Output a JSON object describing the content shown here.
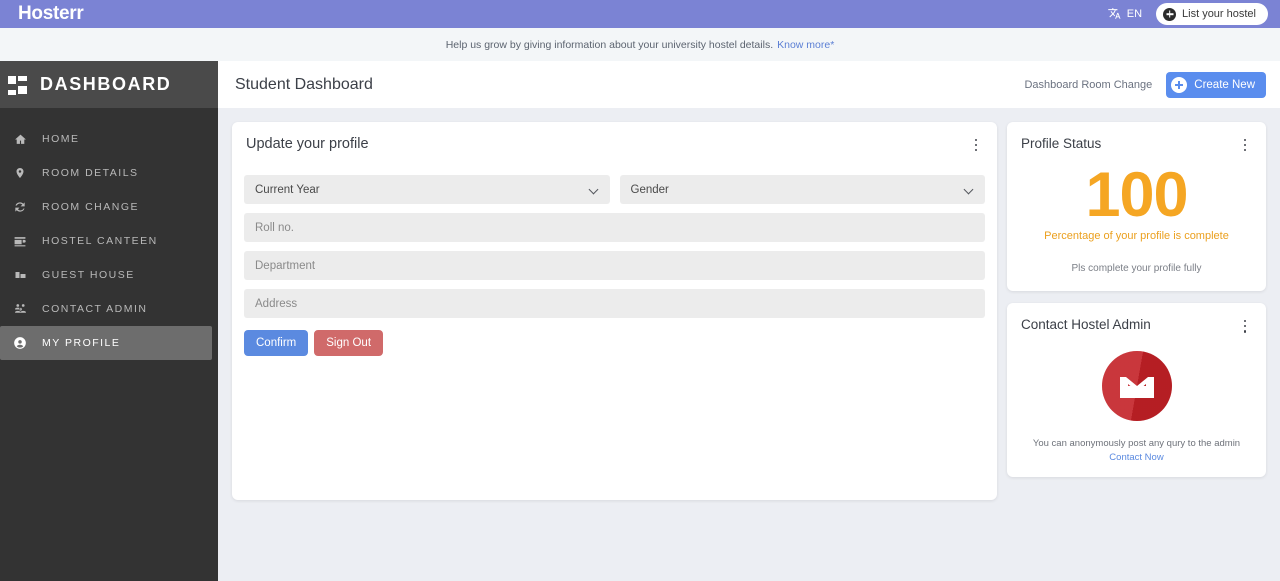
{
  "topbar": {
    "brand": "Hosterr",
    "language": "EN",
    "language_icon": "translate-icon",
    "list_hostel_label": "List your hostel",
    "list_hostel_icon": "plus-circle-icon",
    "background": "#7b83d4"
  },
  "notice": {
    "text": "Help us grow by giving information about your university hostel details.",
    "link_label": "Know more*"
  },
  "sidebar": {
    "title": "DASHBOARD",
    "logo_icon": "dashboard-grid-icon",
    "background": "#333333",
    "active_background": "#6d6d6d",
    "items": [
      {
        "label": "HOME",
        "icon": "home-icon",
        "active": false
      },
      {
        "label": "ROOM DETAILS",
        "icon": "map-pin-icon",
        "active": false
      },
      {
        "label": "ROOM CHANGE",
        "icon": "refresh-icon",
        "active": false
      },
      {
        "label": "HOSTEL CANTEEN",
        "icon": "canteen-icon",
        "active": false
      },
      {
        "label": "GUEST HOUSE",
        "icon": "building-icon",
        "active": false
      },
      {
        "label": "CONTACT ADMIN",
        "icon": "people-group-icon",
        "active": false
      },
      {
        "label": "MY PROFILE",
        "icon": "user-circle-icon",
        "active": true
      }
    ]
  },
  "page_header": {
    "title": "Student Dashboard",
    "breadcrumb": "Dashboard Room Change",
    "create_button_label": "Create New",
    "create_button_icon": "plus-circle-icon",
    "create_button_color": "#5a8dee"
  },
  "profile_form": {
    "title": "Update your profile",
    "menu_icon": "kebab-menu-icon",
    "year_select": {
      "value": "Current Year",
      "icon": "chevron-down-icon"
    },
    "gender_select": {
      "value": "Gender",
      "icon": "chevron-down-icon"
    },
    "roll_no": {
      "value": "",
      "placeholder": "Roll no."
    },
    "department": {
      "value": "",
      "placeholder": "Department"
    },
    "address": {
      "value": "",
      "placeholder": "Address"
    },
    "confirm_label": "Confirm",
    "signout_label": "Sign Out",
    "confirm_color": "#5b8ae0",
    "signout_color": "#d06a6a"
  },
  "profile_status": {
    "title": "Profile Status",
    "menu_icon": "kebab-menu-icon",
    "percentage": "100",
    "percentage_caption": "Percentage of your profile is complete",
    "note": "Pls complete your profile fully",
    "accent_color": "#f5a623"
  },
  "contact_admin": {
    "title": "Contact Hostel Admin",
    "menu_icon": "kebab-menu-icon",
    "mail_icon": "gmail-envelope-icon",
    "description": "You can anonymously post any qury to the admin",
    "link_label": "Contact Now",
    "icon_color": "#c32026"
  }
}
